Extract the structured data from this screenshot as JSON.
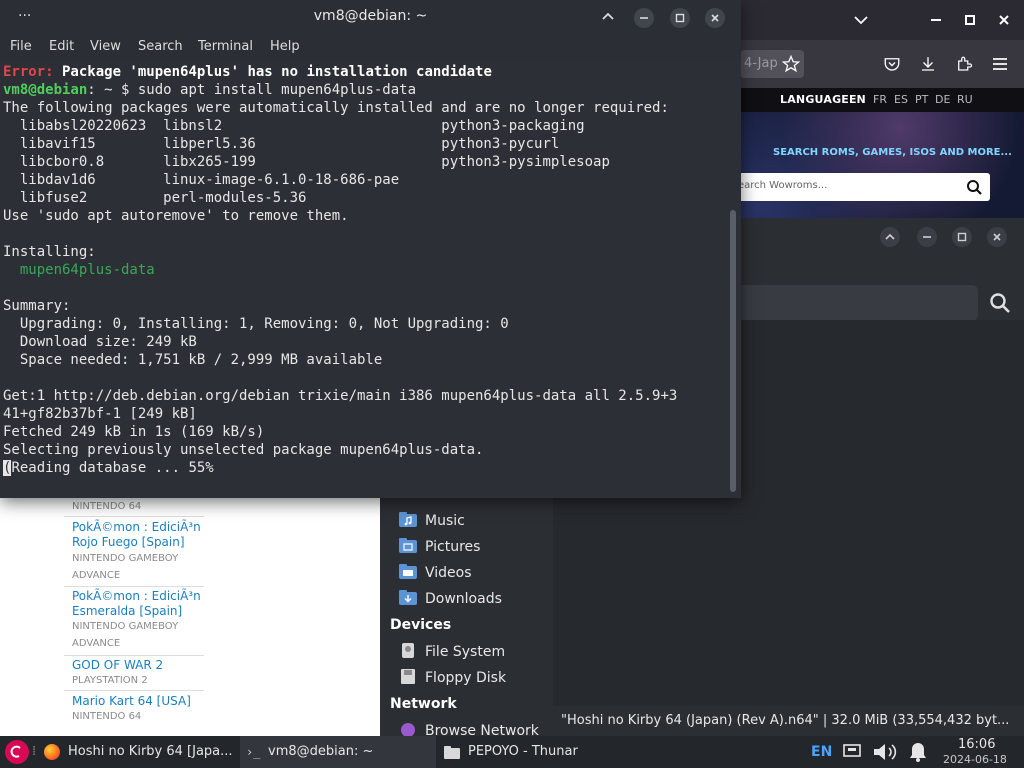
{
  "terminal": {
    "title": "vm8@debian: ~",
    "menu": [
      "File",
      "Edit",
      "View",
      "Search",
      "Terminal",
      "Help"
    ],
    "lines": {
      "l1_err": "Error:",
      "l1_msg": " Package 'mupen64plus' has no installation candidate",
      "l2_user": "vm8@debian",
      "l2_cmd": ": ~ $ sudo apt install mupen64plus-data",
      "l3": "The following packages were automatically installed and are no longer required:",
      "l4": "  libabsl20220623  libnsl2                          python3-packaging",
      "l5": "  libavif15        libperl5.36                      python3-pycurl",
      "l6": "  libcbor0.8       libx265-199                      python3-pysimplesoap",
      "l7": "  libdav1d6        linux-image-6.1.0-18-686-pae",
      "l8": "  libfuse2         perl-modules-5.36",
      "l9": "Use 'sudo apt autoremove' to remove them.",
      "l11": "Installing:",
      "l12": "  mupen64plus-data",
      "l14": "Summary:",
      "l15": "  Upgrading: 0, Installing: 1, Removing: 0, Not Upgrading: 0",
      "l16": "  Download size: 249 kB",
      "l17": "  Space needed: 1,751 kB / 2,999 MB available",
      "l19": "Get:1 http://deb.debian.org/debian trixie/main i386 mupen64plus-data all 2.5.9+3",
      "l20": "41+gf82b37bf-1 [249 kB]",
      "l21": "Fetched 249 kB in 1s (169 kB/s)",
      "l22": "Selecting previously unselected package mupen64plus-data.",
      "l23_cursor": "(",
      "l23": "Reading database ... 55%"
    }
  },
  "firefox": {
    "url_fragment": "4-Jap",
    "page": {
      "language_label": "LANGUAGE",
      "languages": [
        "EN",
        "FR",
        "ES",
        "PT",
        "DE",
        "RU"
      ],
      "tagline": "SEARCH ROMS, GAMES, ISOS AND MORE...",
      "search_placeholder": "earch Wowroms...",
      "games": [
        {
          "title": "",
          "platform": "NINTENDO 64"
        },
        {
          "title": "PokÃ©mon : EdiciÃ³n Rojo Fuego [Spain]",
          "title_a": "PokÃ©mon : EdiciÃ³n",
          "title_b": "Rojo Fuego [Spain]",
          "platform_a": "NINTENDO GAMEBOY",
          "platform_b": "ADVANCE"
        },
        {
          "title_a": "PokÃ©mon : EdiciÃ³n",
          "title_b": "Esmeralda [Spain]",
          "platform_a": "NINTENDO GAMEBOY",
          "platform_b": "ADVANCE"
        },
        {
          "title": "GOD OF WAR 2",
          "platform": "PLAYSTATION 2"
        },
        {
          "title": "Mario Kart 64 [USA]",
          "platform": "NINTENDO 64"
        }
      ]
    }
  },
  "thunar": {
    "places": [
      "Music",
      "Pictures",
      "Videos",
      "Downloads"
    ],
    "devices_heading": "Devices",
    "devices": [
      "File System",
      "Floppy Disk"
    ],
    "network_heading": "Network",
    "network": [
      "Browse Network"
    ],
    "status": "\"Hoshi no Kirby 64 (Japan) (Rev A).n64\" | 32.0 MiB (33,554,432 byt..."
  },
  "taskbar": {
    "tasks": [
      "Hoshi no Kirby 64 [Japa...",
      "vm8@debian: ~",
      "PEPOYO - Thunar"
    ],
    "keyboard_layout": "EN",
    "time": "16:06",
    "date": "2024-06-18"
  },
  "colors": {
    "terminal_bg": "#2c3036",
    "error_red": "#e04848",
    "prompt_green": "#4fce5c",
    "link_blue": "#1a7fc0"
  }
}
